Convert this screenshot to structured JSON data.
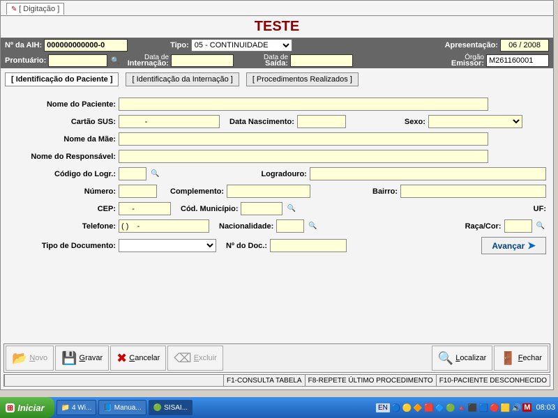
{
  "window": {
    "tab_title": "[ Digitação ]",
    "title": "TESTE"
  },
  "header": {
    "aih_label": "Nº da AIH:",
    "aih_value": "000000000000-0",
    "tipo_label": "Tipo:",
    "tipo_value": "05 - CONTINUIDADE",
    "apresentacao_label": "Apresentação:",
    "apresentacao_value": "06 / 2008",
    "prontuario_label": "Prontuário:",
    "prontuario_value": "",
    "data_intern_label1": "Data de",
    "data_intern_label2": "Internação:",
    "data_intern_value": "",
    "data_saida_label1": "Data de",
    "data_saida_label2": "Saída:",
    "data_saida_value": "",
    "orgao_label1": "Órgão",
    "orgao_label2": "Emissor:",
    "orgao_value": "M261160001"
  },
  "tabs": {
    "t1": "[ Identificação do Paciente ]",
    "t2": "[ Identificação da Internação ]",
    "t3": "[ Procedimentos Realizados ]"
  },
  "form": {
    "nome_paciente_label": "Nome do Paciente:",
    "nome_paciente_value": "",
    "cartao_sus_label": "Cartão SUS:",
    "cartao_sus_value": "           -",
    "data_nasc_label": "Data Nascimento:",
    "data_nasc_value": "",
    "sexo_label": "Sexo:",
    "sexo_value": "",
    "nome_mae_label": "Nome da Mãe:",
    "nome_mae_value": "",
    "nome_resp_label": "Nome do Responsável:",
    "nome_resp_value": "",
    "cod_logr_label": "Código do Logr.:",
    "cod_logr_value": "",
    "logradouro_label": "Logradouro:",
    "logradouro_value": "",
    "numero_label": "Número:",
    "numero_value": "",
    "complemento_label": "Complemento:",
    "complemento_value": "",
    "bairro_label": "Bairro:",
    "bairro_value": "",
    "cep_label": "CEP:",
    "cep_value": "     -",
    "cod_mun_label": "Cód. Município:",
    "cod_mun_value": "",
    "uf_label": "UF:",
    "telefone_label": "Telefone:",
    "telefone_value": "( )    -",
    "nacionalidade_label": "Nacionalidade:",
    "nacionalidade_value": "",
    "raca_label": "Raça/Cor:",
    "raca_value": "",
    "tipo_doc_label": "Tipo de Documento:",
    "tipo_doc_value": "",
    "n_doc_label": "Nº do Doc.:",
    "n_doc_value": "",
    "avancar": "Avançar"
  },
  "toolbar": {
    "novo": "Novo",
    "gravar": "Gravar",
    "cancelar": "Cancelar",
    "excluir": "Excluir",
    "localizar": "Localizar",
    "fechar": "Fechar"
  },
  "status": {
    "f1": "F1-CONSULTA TABELA",
    "f8": "F8-REPETE ÚLTIMO PROCEDIMENTO",
    "f10": "F10-PACIENTE DESCONHECIDO"
  },
  "taskbar": {
    "start": "Iniciar",
    "items": {
      "i0": "4 Wi...",
      "i1": "Manua...",
      "i2": "SISAI..."
    },
    "lang": "EN",
    "clock": "08:03"
  }
}
